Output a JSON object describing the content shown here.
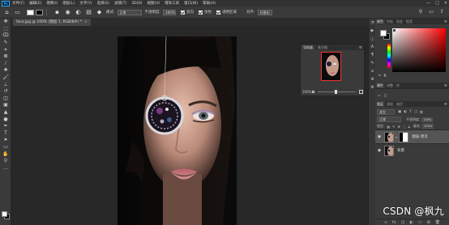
{
  "menubar": {
    "logo": "Ps",
    "items": [
      "文件(F)",
      "编辑(E)",
      "图像(I)",
      "图层(L)",
      "文字(Y)",
      "选择(S)",
      "滤镜(T)",
      "3D(D)",
      "视图(V)",
      "增效工具",
      "窗口(W)",
      "帮助(H)"
    ],
    "win_minimize": "—",
    "win_maximize": "□",
    "win_close": "✕"
  },
  "options": {
    "mode_label": "模式:",
    "mode_value": "正常",
    "opacity_label": "不透明度:",
    "opacity_value": "100%",
    "reverse_label": "反向",
    "dither_label": "仿色",
    "transparency_label": "透明区域",
    "align_label": "对齐:",
    "align_value": "任意化"
  },
  "document": {
    "tab_title": "face.jpg @ 100% (图层 1, RGB/8#) *",
    "close_icon": "×"
  },
  "navigator": {
    "tabs": [
      "导航器",
      "直方图"
    ],
    "zoom": "100%"
  },
  "panels": {
    "color_tabs": [
      "颜色",
      "色板",
      "渐变",
      "图案"
    ],
    "props_tabs": [
      "属性",
      "调整",
      "库"
    ],
    "layers_tabs": [
      "图层",
      "通道",
      "路径"
    ],
    "layers_search": "类型",
    "blend_mode": "正常",
    "opacity_label": "不透明度:",
    "opacity_value": "100%",
    "lock_label": "锁定:",
    "fill_label": "填充:",
    "fill_value": "100%"
  },
  "layers": [
    {
      "name": "图层 拷贝",
      "selected": true,
      "has_mask": true
    },
    {
      "name": "背景",
      "selected": false,
      "has_mask": false
    }
  ],
  "colors": {
    "foreground": "#ffffff",
    "background": "#000000",
    "accent": "#31a8ff"
  },
  "watermark": "CSDN @枫九"
}
